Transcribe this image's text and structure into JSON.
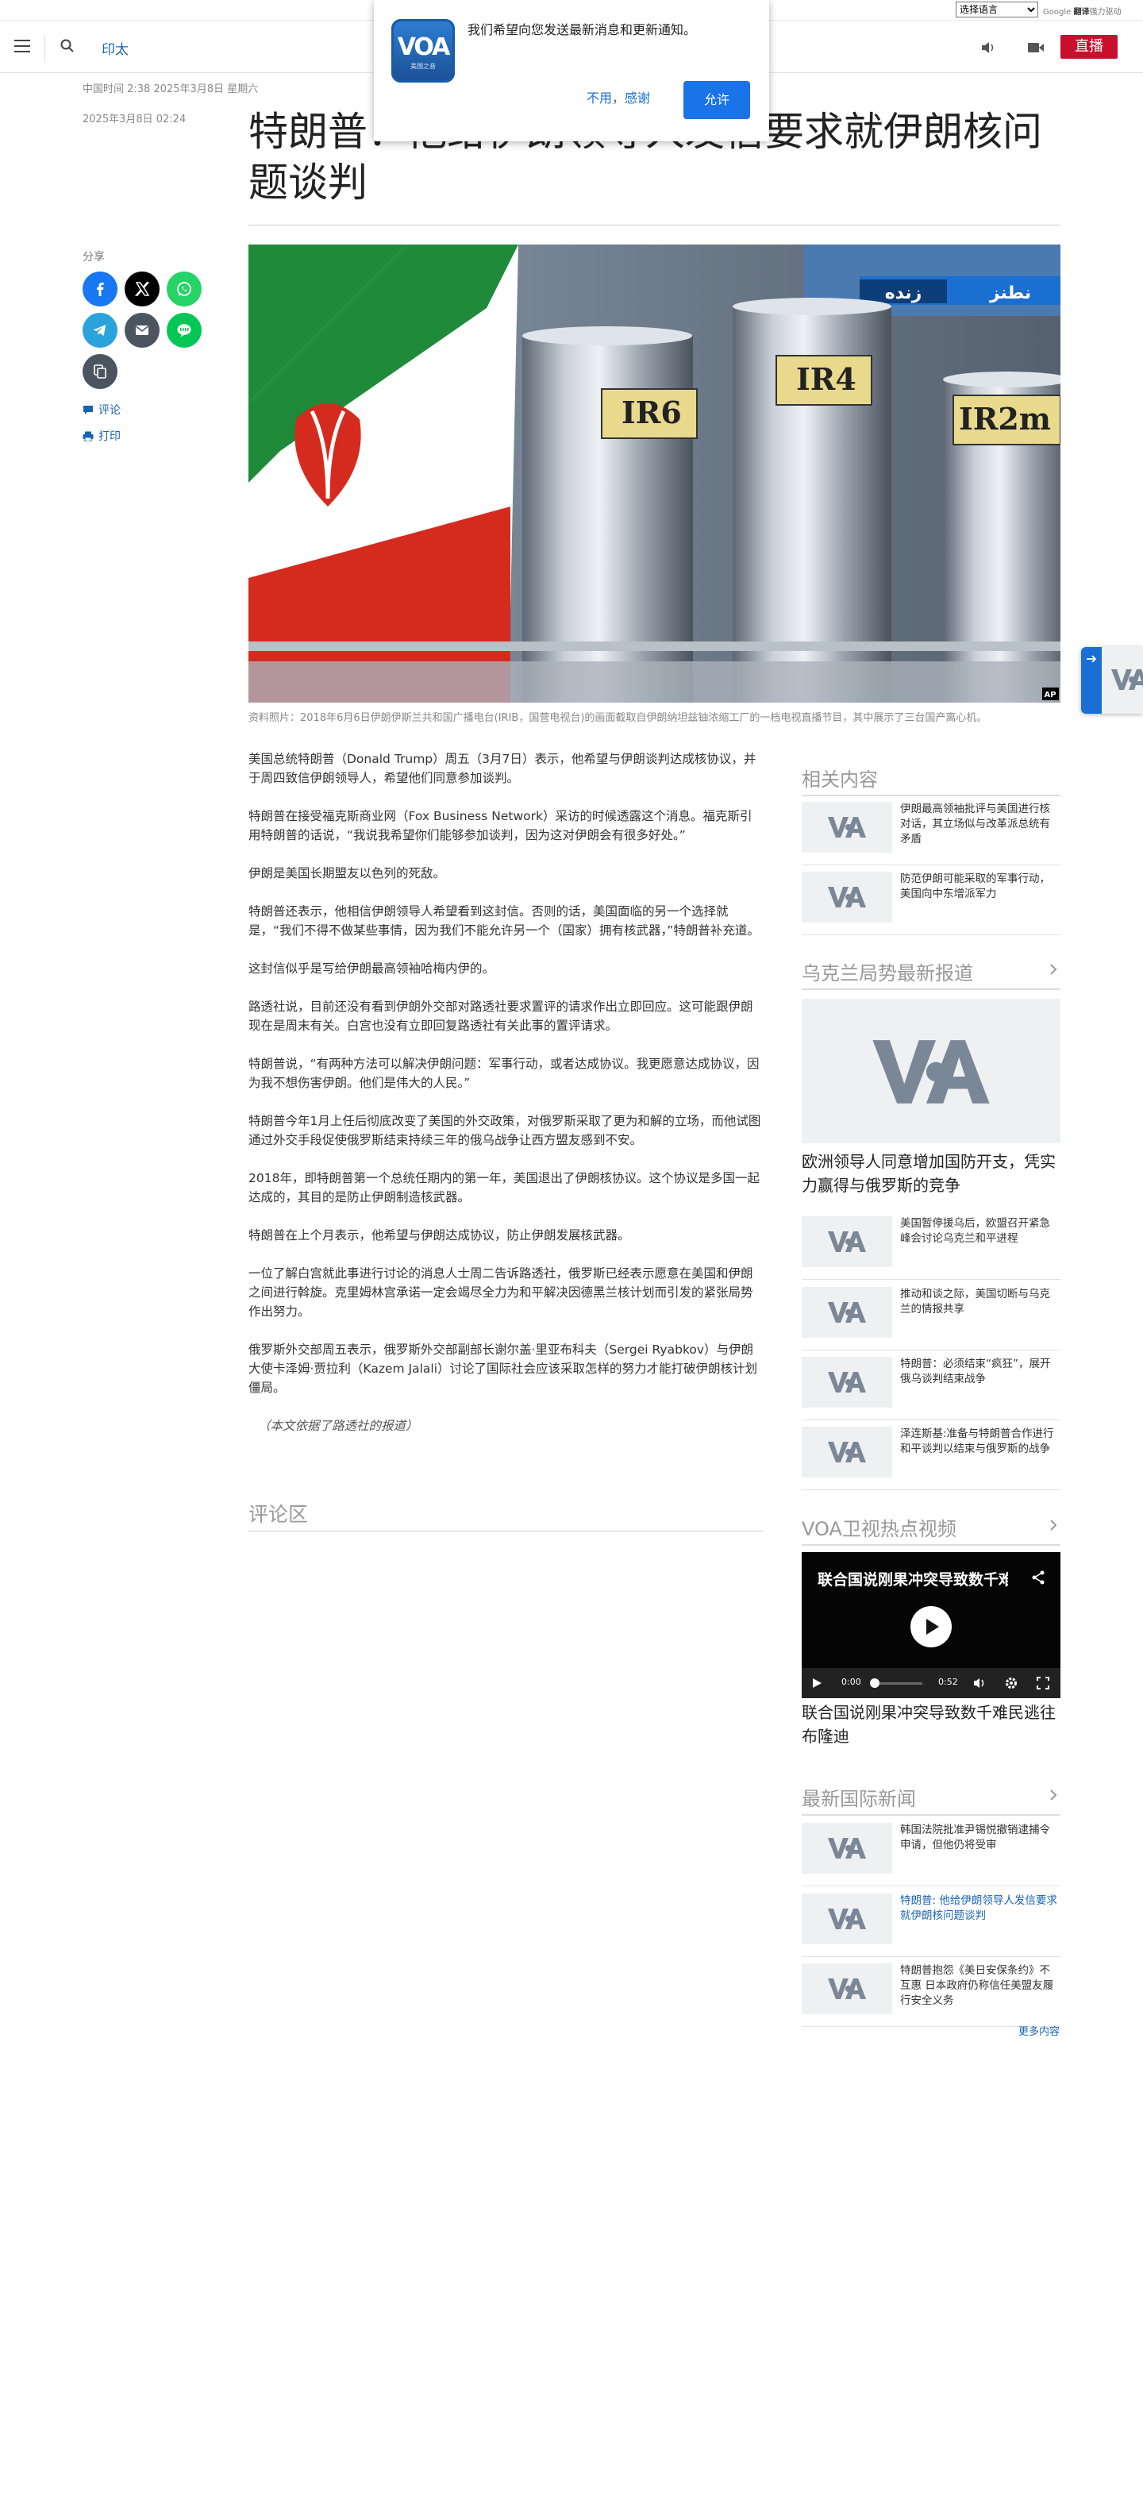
{
  "translate_bar": {
    "language_select": "选择语言",
    "powered_prefix": "Google",
    "powered_brand": "翻译",
    "powered_suffix": "强力驱动"
  },
  "header": {
    "section": "印太",
    "live_label": "直播"
  },
  "notification": {
    "logo_text": "VOA",
    "logo_sub": "美国之音",
    "message": "我们希望向您发送最新消息和更新通知。",
    "decline_label": "不用，感谢",
    "allow_label": "允许"
  },
  "article": {
    "dateline": "中国时间 2:38 2025年3月8日 星期六",
    "published": "2025年3月8日 02:24",
    "title": "特朗普：他给伊朗领导人发信要求就伊朗核问题谈判",
    "share_label": "分享",
    "comment_label": "评论",
    "print_label": "打印",
    "hero_labels": [
      "IR6",
      "IR4",
      "IR2m",
      "نطنز",
      "زنده",
      "AP"
    ],
    "caption": "资料照片：2018年6月6日伊朗伊斯兰共和国广播电台(IRIB，国营电视台)的画面截取自伊朗纳坦兹铀浓缩工厂的一档电视直播节目，其中展示了三台国产离心机。",
    "paragraphs": [
      "美国总统特朗普（Donald Trump）周五（3月7日）表示，他希望与伊朗谈判达成核协议，并于周四致信伊朗领导人，希望他们同意参加谈判。",
      "特朗普在接受福克斯商业网（Fox Business Network）采访的时候透露这个消息。福克斯引用特朗普的话说，“我说我希望你们能够参加谈判，因为这对伊朗会有很多好处。”",
      "伊朗是美国长期盟友以色列的死敌。",
      "特朗普还表示，他相信伊朗领导人希望看到这封信。否则的话，美国面临的另一个选择就是，“我们不得不做某些事情，因为我们不能允许另一个（国家）拥有核武器，”特朗普补充道。",
      "这封信似乎是写给伊朗最高领袖哈梅内伊的。",
      "路透社说，目前还没有看到伊朗外交部对路透社要求置评的请求作出立即回应。这可能跟伊朗现在是周末有关。白宫也没有立即回复路透社有关此事的置评请求。",
      "特朗普说，“有两种方法可以解决伊朗问题：军事行动，或者达成协议。我更愿意达成协议，因为我不想伤害伊朗。他们是伟大的人民。”",
      "特朗普今年1月上任后彻底改变了美国的外交政策，对俄罗斯采取了更为和解的立场，而他试图通过外交手段促使俄罗斯结束持续三年的俄乌战争让西方盟友感到不安。",
      "2018年，即特朗普第一个总统任期内的第一年，美国退出了伊朗核协议。这个协议是多国一起达成的，其目的是防止伊朗制造核武器。",
      "特朗普在上个月表示，他希望与伊朗达成协议，防止伊朗发展核武器。",
      "一位了解白宫就此事进行讨论的消息人士周二告诉路透社，俄罗斯已经表示愿意在美国和伊朗之间进行斡旋。克里姆林宫承诺一定会竭尽全力为和平解决因德黑兰核计划而引发的紧张局势作出努力。",
      "俄罗斯外交部周五表示，俄罗斯外交部副部长谢尔盖·里亚布科夫（Sergei Ryabkov）与伊朗大使卡泽姆·贾拉利（Kazem Jalali）讨论了国际社会应该采取怎样的努力才能打破伊朗核计划僵局。"
    ],
    "credit": "（本文依据了路透社的报道）",
    "comments_title": "评论区"
  },
  "sidebar": {
    "related_title": "相关内容",
    "related": [
      "伊朗最高领袖批评与美国进行核对话，其立场似与改革派总统有矛盾",
      "防范伊朗可能采取的军事行动，美国向中东增派军力"
    ],
    "ukraine_title": "乌克兰局势最新报道",
    "ukraine_lead": "欧洲领导人同意增加国防开支，凭实力赢得与俄罗斯的竞争",
    "ukraine": [
      "美国暂停援乌后，欧盟召开紧急峰会讨论乌克兰和平进程",
      "推动和谈之际，美国切断与乌克兰的情报共享",
      "特朗普：必须结束“疯狂”，展开俄乌谈判结束战争",
      "泽连斯基:准备与特朗普合作进行和平谈判以结束与俄罗斯的战争"
    ],
    "video_section_title": "VOA卫视热点视频",
    "video_title": "联合国说刚果冲突导致数千难民逃往布隆迪",
    "video_time_current": "0:00",
    "video_time_total": "0:52",
    "video_caption": "联合国说刚果冲突导致数千难民逃往布隆迪",
    "intl_title": "最新国际新闻",
    "intl": [
      "韩国法院批准尹锡悦撤销逮捕令申请，但他仍将受审",
      "特朗普: 他给伊朗领导人发信要求就伊朗核问题谈判",
      "特朗普抱怨《美日安保条约》不互惠 日本政府仍称信任美盟友履行安全义务"
    ],
    "more_label": "更多内容"
  },
  "colors": {
    "accent_blue": "#1a63b4",
    "live_red": "#c8102e",
    "facebook": "#1877f2",
    "x": "#000000",
    "whatsapp": "#25d366",
    "telegram": "#2aa3dc",
    "email": "#4a5560",
    "line": "#06c755",
    "copy": "#4a5560"
  },
  "icons": [
    "menu-icon",
    "search-icon",
    "audio-icon",
    "video-icon",
    "facebook-icon",
    "x-icon",
    "whatsapp-icon",
    "telegram-icon",
    "email-icon",
    "line-icon",
    "copy-link-icon",
    "comment-icon",
    "print-icon",
    "chevron-right-icon",
    "share-icon",
    "play-icon",
    "volume-icon",
    "settings-icon",
    "fullscreen-icon",
    "arrow-right-icon"
  ]
}
